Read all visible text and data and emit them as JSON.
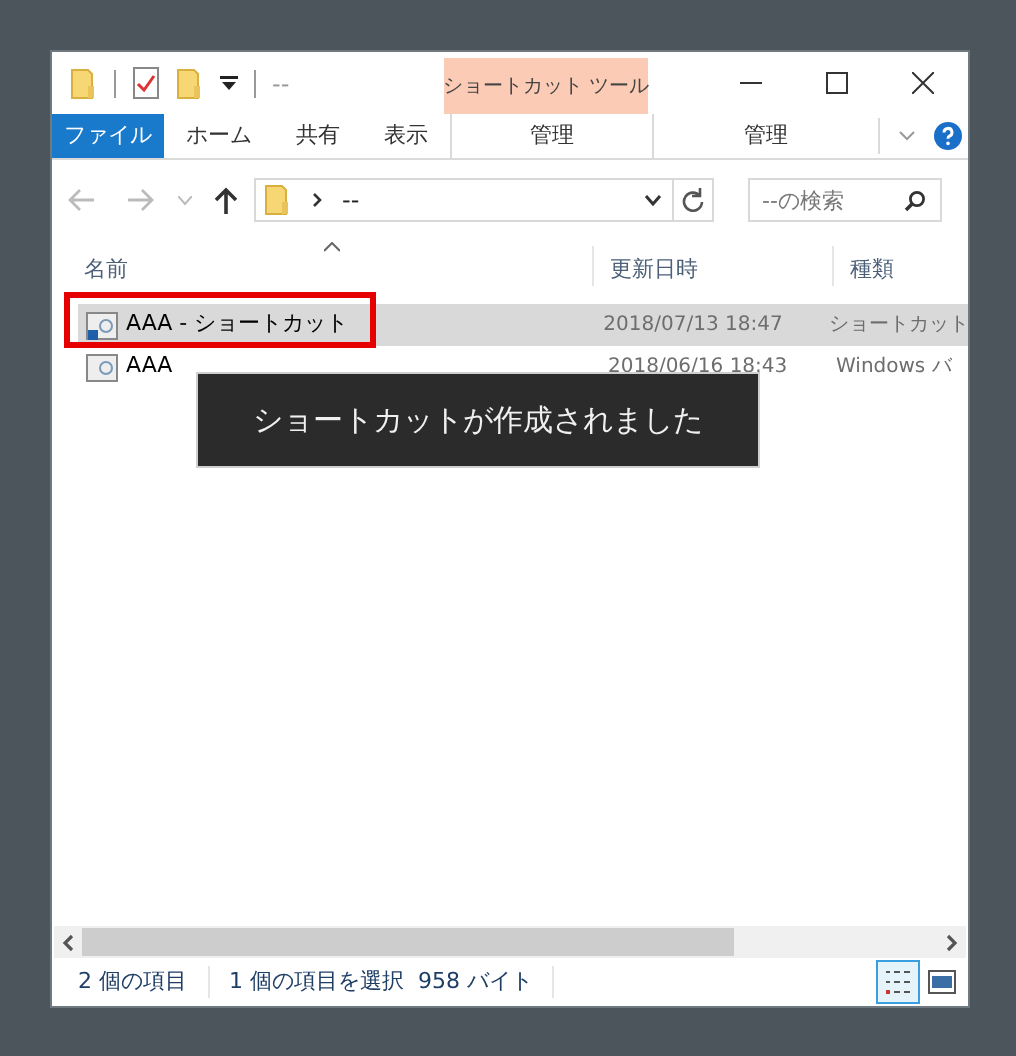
{
  "window": {
    "title": "--",
    "context_tab": "ショートカット ツール"
  },
  "ribbon_tabs": [
    {
      "label": "ファイル",
      "kind": "file",
      "selected": false
    },
    {
      "label": "ホーム",
      "kind": "tab",
      "selected": false
    },
    {
      "label": "共有",
      "kind": "tab",
      "selected": false
    },
    {
      "label": "表示",
      "kind": "tab",
      "selected": false
    },
    {
      "label": "管理",
      "kind": "context",
      "selected": false
    },
    {
      "label": "管理",
      "kind": "tab",
      "selected": false
    }
  ],
  "address_bar": {
    "path": "--",
    "search_placeholder": "--の検索"
  },
  "columns": [
    "名前",
    "更新日時",
    "種類"
  ],
  "rows": [
    {
      "name": "AAA - ショートカット",
      "date": "2018/07/13 18:47",
      "type": "ショートカット",
      "selected": true,
      "highlighted": true
    },
    {
      "name": "AAA",
      "date": "2018/06/16 18:43",
      "type": "Windows バ",
      "selected": false,
      "highlighted": false
    }
  ],
  "toast": "ショートカットが作成されました",
  "status_bar": {
    "count": "2 個の項目",
    "selection": "1 個の項目を選択  958 バイト"
  }
}
